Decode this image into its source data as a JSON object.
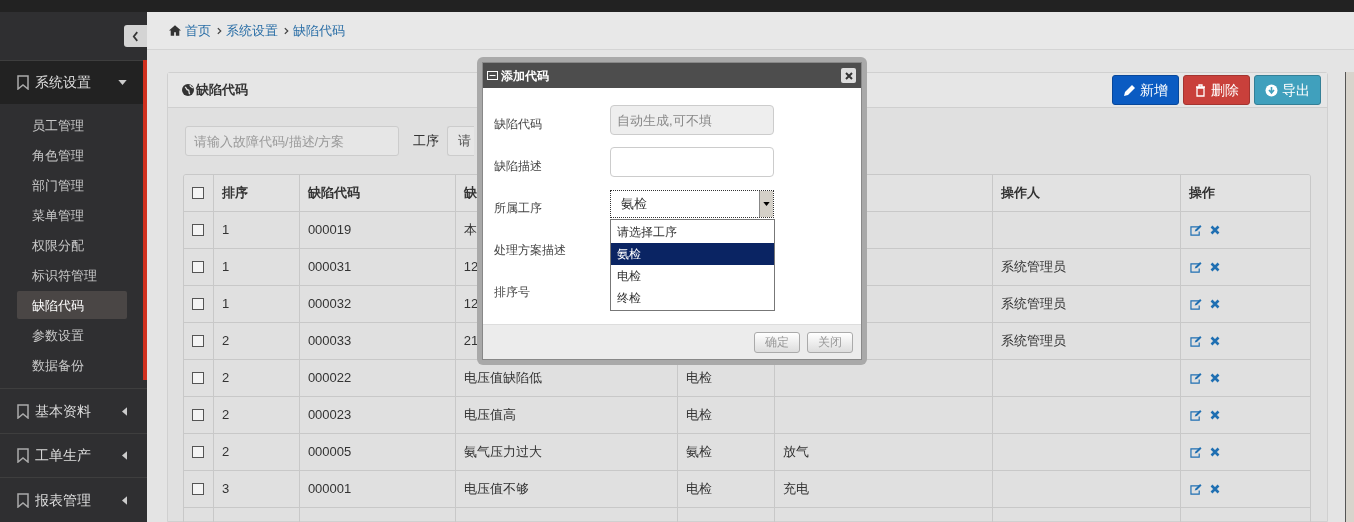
{
  "sidebar": {
    "sections": [
      {
        "label": "系统设置",
        "expanded": true,
        "items": [
          {
            "label": "员工管理",
            "selected": false
          },
          {
            "label": "角色管理",
            "selected": false
          },
          {
            "label": "部门管理",
            "selected": false
          },
          {
            "label": "菜单管理",
            "selected": false
          },
          {
            "label": "权限分配",
            "selected": false
          },
          {
            "label": "标识符管理",
            "selected": false
          },
          {
            "label": "缺陷代码",
            "selected": true
          },
          {
            "label": "参数设置",
            "selected": false
          },
          {
            "label": "数据备份",
            "selected": false
          }
        ]
      },
      {
        "label": "基本资料",
        "expanded": false
      },
      {
        "label": "工单生产",
        "expanded": false
      },
      {
        "label": "报表管理",
        "expanded": false
      }
    ]
  },
  "breadcrumb": [
    "首页",
    "系统设置",
    "缺陷代码"
  ],
  "panel": {
    "title": "缺陷代码",
    "buttons": [
      {
        "kind": "add",
        "label": "新增"
      },
      {
        "kind": "delete",
        "label": "删除"
      },
      {
        "kind": "export",
        "label": "导出"
      }
    ],
    "filter": {
      "placeholder": "请输入故障代码/描述/方案",
      "process_label": "工序",
      "process_value": "请"
    },
    "table": {
      "select_all_checked": false,
      "columns": [
        {
          "label": "排序"
        },
        {
          "label": "缺陷代码"
        },
        {
          "label": "缺"
        },
        {},
        {},
        {
          "label": "操作人"
        },
        {
          "label": "操作"
        }
      ],
      "rows": [
        {
          "checked": false,
          "sort": "1",
          "code": "000019",
          "description": "本"
        },
        {
          "checked": false,
          "sort": "1",
          "code": "000031",
          "description": "12",
          "operator": "系统管理员"
        },
        {
          "checked": false,
          "sort": "1",
          "code": "000032",
          "description": "12",
          "operator": "系统管理员"
        },
        {
          "checked": false,
          "sort": "2",
          "code": "000033",
          "description": "21",
          "operator": "系统管理员"
        },
        {
          "checked": false,
          "sort": "2",
          "code": "000022",
          "description": "电压值缺陷低",
          "process": "电检"
        },
        {
          "checked": false,
          "sort": "2",
          "code": "000023",
          "description": "电压值高",
          "process": "电检"
        },
        {
          "checked": false,
          "sort": "2",
          "code": "000005",
          "description": "氨气压力过大",
          "process": "氨检",
          "solution": "放气"
        },
        {
          "checked": false,
          "sort": "3",
          "code": "000001",
          "description": "电压值不够",
          "process": "电检",
          "solution": "充电"
        }
      ]
    }
  },
  "dialog": {
    "title": "添加代码",
    "fields": [
      {
        "kind": "text",
        "label": "缺陷代码",
        "placeholder": "自动生成,可不填",
        "disabled": true
      },
      {
        "kind": "text",
        "label": "缺陷描述",
        "disabled": false
      },
      {
        "kind": "select",
        "label": "所属工序",
        "value": "氨检",
        "expanded": true,
        "options": [
          {
            "label": "请选择工序",
            "selected": false
          },
          {
            "label": "氨检",
            "selected": true
          },
          {
            "label": "电检",
            "selected": false
          },
          {
            "label": "终检",
            "selected": false
          }
        ]
      },
      {
        "kind": "covered",
        "label": "处理方案描述"
      },
      {
        "kind": "covered",
        "label": "排序号"
      }
    ],
    "buttons": [
      {
        "label": "确定"
      },
      {
        "label": "关闭"
      }
    ]
  }
}
